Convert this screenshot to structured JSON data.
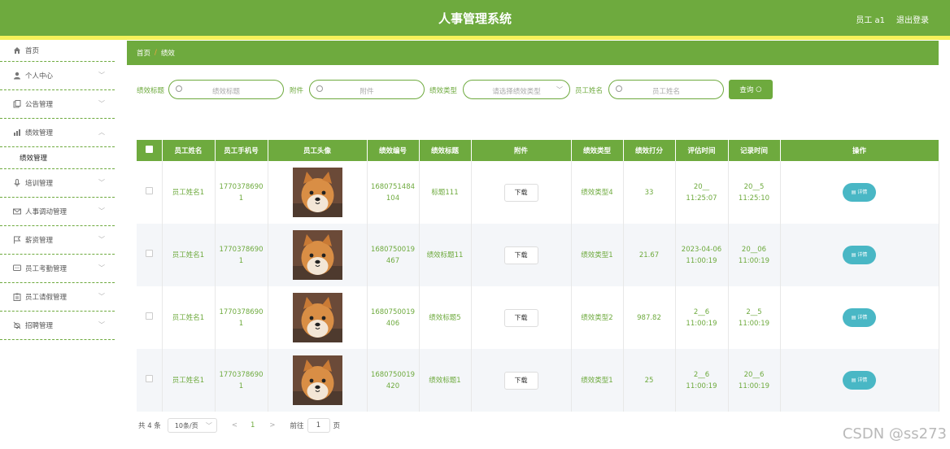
{
  "header": {
    "title": "人事管理系统",
    "user": "员工 a1",
    "logout": "退出登录"
  },
  "sidebar": {
    "items": [
      {
        "label": "首页",
        "icon": "home-icon"
      },
      {
        "label": "个人中心",
        "icon": "user-icon"
      },
      {
        "label": "公告管理",
        "icon": "copy-icon"
      },
      {
        "label": "绩效管理",
        "icon": "chart-icon"
      },
      {
        "label": "绩效管理",
        "icon": ""
      },
      {
        "label": "培训管理",
        "icon": "mic-icon"
      },
      {
        "label": "人事调动管理",
        "icon": "mail-icon"
      },
      {
        "label": "薪资管理",
        "icon": "flag-icon"
      },
      {
        "label": "员工考勤管理",
        "icon": "chat-icon"
      },
      {
        "label": "员工请假管理",
        "icon": "clipboard-icon"
      },
      {
        "label": "招聘管理",
        "icon": "bell-icon"
      }
    ]
  },
  "breadcrumb": {
    "home": "首页",
    "sep": "/",
    "current": "绩效"
  },
  "search": {
    "title_label": "绩效标题",
    "title_ph": "绩效标题",
    "attach_label": "附件",
    "attach_ph": "附件",
    "type_label": "绩效类型",
    "type_ph": "请选择绩效类型",
    "name_label": "员工姓名",
    "name_ph": "员工姓名",
    "button": "查询"
  },
  "table": {
    "headers": [
      "员工姓名",
      "员工手机号",
      "员工头像",
      "绩效编号",
      "绩效标题",
      "附件",
      "绩效类型",
      "绩效打分",
      "评估时间",
      "记录时间",
      "操作"
    ],
    "download": "下载",
    "detail": "详情",
    "rows": [
      {
        "name": "员工姓名1",
        "phone": "1770378690\n1",
        "code": "1680751484\n104",
        "title": "标题111",
        "type": "绩效类型4",
        "score": "33",
        "eval": "20__\n11:25:07",
        "rec": "20__5\n11:25:10"
      },
      {
        "name": "员工姓名1",
        "phone": "1770378690\n1",
        "code": "1680750019\n467",
        "title": "绩效标题11",
        "type": "绩效类型1",
        "score": "21.67",
        "eval": "2023-04-06\n11:00:19",
        "rec": "20__06\n11:00:19"
      },
      {
        "name": "员工姓名1",
        "phone": "1770378690\n1",
        "code": "1680750019\n406",
        "title": "绩效标题5",
        "type": "绩效类型2",
        "score": "987.82",
        "eval": "2__6\n11:00:19",
        "rec": "2__5\n11:00:19"
      },
      {
        "name": "员工姓名1",
        "phone": "1770378690\n1",
        "code": "1680750019\n420",
        "title": "绩效标题1",
        "type": "绩效类型1",
        "score": "25",
        "eval": "2__6\n11:00:19",
        "rec": "20__6\n11:00:19"
      }
    ]
  },
  "pager": {
    "total": "共 4 条",
    "size": "10条/页",
    "prev": "<",
    "page": "1",
    "next": ">",
    "goto": "前往",
    "goto_val": "1",
    "ye": "页"
  },
  "watermark": "CSDN @ss273"
}
